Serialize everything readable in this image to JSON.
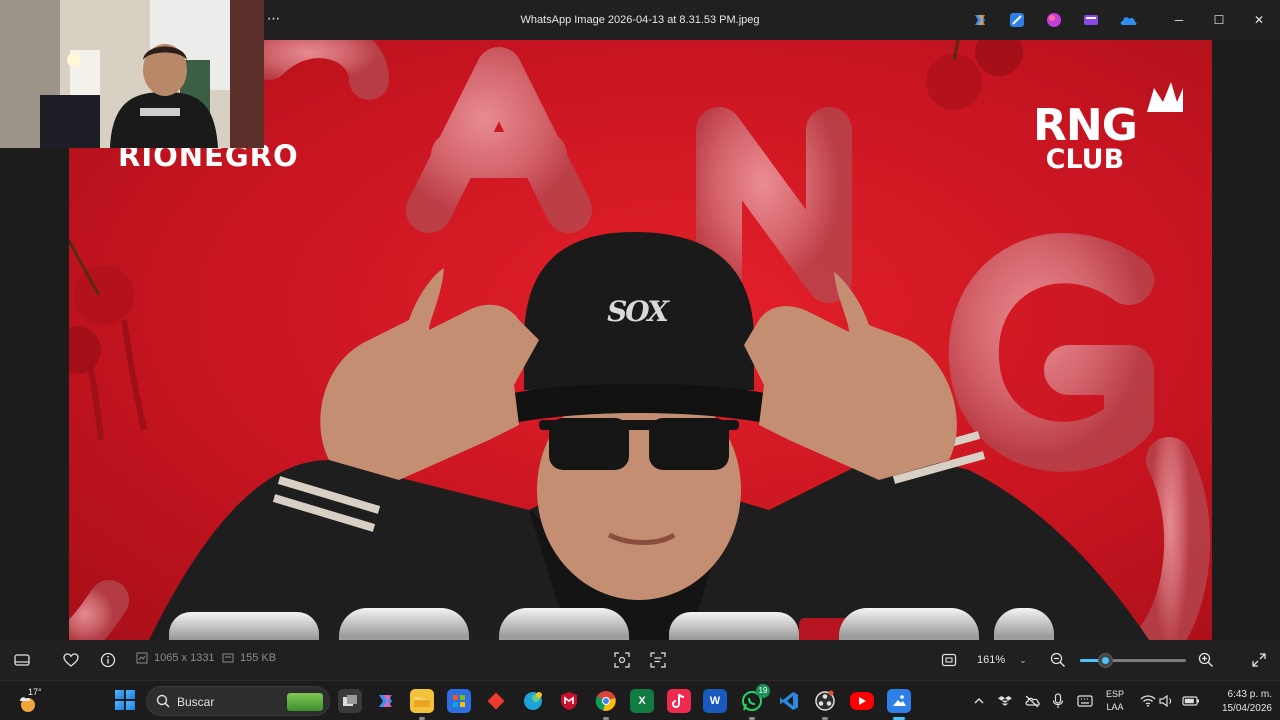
{
  "window": {
    "title": "WhatsApp Image 2026-04-13 at 8.31.53 PM.jpeg",
    "more_label": "···",
    "controls": {
      "minimize": "─",
      "maximize": "☐",
      "close": "✕"
    },
    "app_icons": [
      "copilot-icon",
      "photo-editor-icon",
      "designer-icon",
      "clipchamp-icon",
      "onedrive-icon"
    ]
  },
  "photo": {
    "brand_left": "RIONEGRO",
    "brand_right_top": "RNG",
    "brand_right_bottom": "CLUB",
    "cap_logo": "SOX"
  },
  "image_toolbar": {
    "dimensions": "1065 x 1331",
    "file_size": "155 KB",
    "zoom_label": "161%",
    "zoom_level": 0.24
  },
  "taskbar": {
    "weather_temp": "17°",
    "search_label": "Buscar",
    "whatsapp_badge": "19",
    "lang_top": "ESP",
    "lang_bottom": "LAA",
    "time": "6:43 p. m.",
    "date": "15/04/2026",
    "colors": {
      "accent": "#4cc2ff",
      "poster_red": "#d41b25"
    }
  }
}
